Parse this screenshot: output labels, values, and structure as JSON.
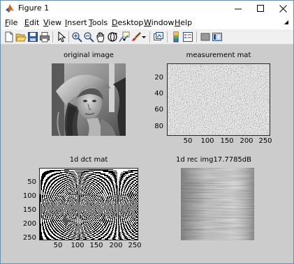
{
  "window": {
    "title": "Figure 1",
    "app_icon": "matlab-icon",
    "controls": [
      "minimize-icon",
      "maximize-icon",
      "close-icon"
    ]
  },
  "menu": {
    "items": [
      {
        "pre": "",
        "mn": "F",
        "post": "ile"
      },
      {
        "pre": "",
        "mn": "E",
        "post": "dit"
      },
      {
        "pre": "",
        "mn": "V",
        "post": "iew"
      },
      {
        "pre": "",
        "mn": "I",
        "post": "nsert"
      },
      {
        "pre": "",
        "mn": "T",
        "post": "ools"
      },
      {
        "pre": "",
        "mn": "D",
        "post": "esktop"
      },
      {
        "pre": "",
        "mn": "W",
        "post": "indow"
      },
      {
        "pre": "",
        "mn": "H",
        "post": "elp"
      }
    ]
  },
  "toolbar": {
    "icons": [
      "new-figure-icon",
      "open-file-icon",
      "save-icon",
      "print-icon",
      "pointer-icon",
      "zoom-in-icon",
      "zoom-out-icon",
      "pan-icon",
      "rotate-3d-icon",
      "data-cursor-icon",
      "brush-icon",
      "link-plot-icon",
      "colorbar-icon",
      "legend-icon",
      "hide-plot-tools-icon",
      "show-plot-tools-icon"
    ]
  },
  "figure": {
    "background": "#cccccc",
    "subplots": [
      {
        "title": "original image",
        "type": "image",
        "colormap": "gray",
        "axis": "off"
      },
      {
        "title": "measurement mat",
        "type": "image",
        "colormap": "gray",
        "yticks": [
          "20",
          "40",
          "60",
          "80"
        ],
        "xticks": [
          "50",
          "100",
          "150",
          "200",
          "250"
        ],
        "xlim": [
          1,
          256
        ],
        "ylim": [
          1,
          88
        ]
      },
      {
        "title": "1d dct mat",
        "type": "image",
        "colormap": "gray",
        "yticks": [
          "50",
          "100",
          "150",
          "200",
          "250"
        ],
        "xticks": [
          "50",
          "100",
          "150",
          "200",
          "250"
        ],
        "xlim": [
          1,
          256
        ],
        "ylim": [
          1,
          256
        ]
      },
      {
        "title": "1d rec img17.7785dB",
        "type": "image",
        "colormap": "gray",
        "axis": "off"
      }
    ]
  }
}
